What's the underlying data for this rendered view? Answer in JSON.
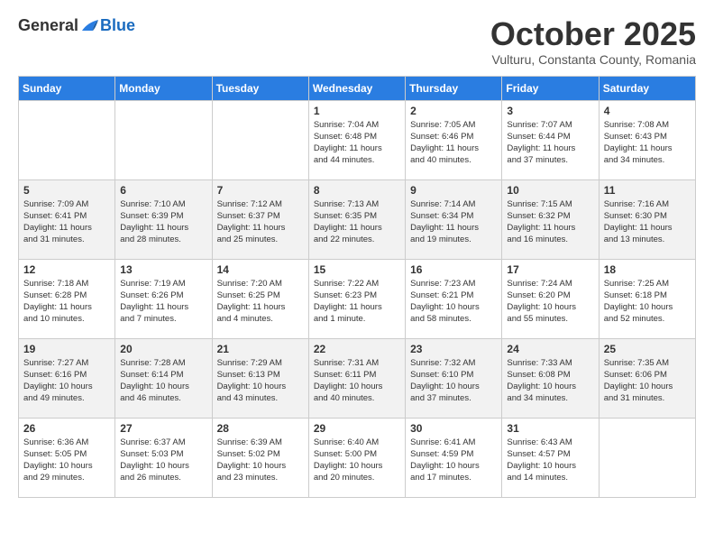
{
  "header": {
    "logo_general": "General",
    "logo_blue": "Blue",
    "month_title": "October 2025",
    "location": "Vulturu, Constanta County, Romania"
  },
  "weekdays": [
    "Sunday",
    "Monday",
    "Tuesday",
    "Wednesday",
    "Thursday",
    "Friday",
    "Saturday"
  ],
  "weeks": [
    [
      {
        "day": "",
        "info": ""
      },
      {
        "day": "",
        "info": ""
      },
      {
        "day": "",
        "info": ""
      },
      {
        "day": "1",
        "info": "Sunrise: 7:04 AM\nSunset: 6:48 PM\nDaylight: 11 hours\nand 44 minutes."
      },
      {
        "day": "2",
        "info": "Sunrise: 7:05 AM\nSunset: 6:46 PM\nDaylight: 11 hours\nand 40 minutes."
      },
      {
        "day": "3",
        "info": "Sunrise: 7:07 AM\nSunset: 6:44 PM\nDaylight: 11 hours\nand 37 minutes."
      },
      {
        "day": "4",
        "info": "Sunrise: 7:08 AM\nSunset: 6:43 PM\nDaylight: 11 hours\nand 34 minutes."
      }
    ],
    [
      {
        "day": "5",
        "info": "Sunrise: 7:09 AM\nSunset: 6:41 PM\nDaylight: 11 hours\nand 31 minutes."
      },
      {
        "day": "6",
        "info": "Sunrise: 7:10 AM\nSunset: 6:39 PM\nDaylight: 11 hours\nand 28 minutes."
      },
      {
        "day": "7",
        "info": "Sunrise: 7:12 AM\nSunset: 6:37 PM\nDaylight: 11 hours\nand 25 minutes."
      },
      {
        "day": "8",
        "info": "Sunrise: 7:13 AM\nSunset: 6:35 PM\nDaylight: 11 hours\nand 22 minutes."
      },
      {
        "day": "9",
        "info": "Sunrise: 7:14 AM\nSunset: 6:34 PM\nDaylight: 11 hours\nand 19 minutes."
      },
      {
        "day": "10",
        "info": "Sunrise: 7:15 AM\nSunset: 6:32 PM\nDaylight: 11 hours\nand 16 minutes."
      },
      {
        "day": "11",
        "info": "Sunrise: 7:16 AM\nSunset: 6:30 PM\nDaylight: 11 hours\nand 13 minutes."
      }
    ],
    [
      {
        "day": "12",
        "info": "Sunrise: 7:18 AM\nSunset: 6:28 PM\nDaylight: 11 hours\nand 10 minutes."
      },
      {
        "day": "13",
        "info": "Sunrise: 7:19 AM\nSunset: 6:26 PM\nDaylight: 11 hours\nand 7 minutes."
      },
      {
        "day": "14",
        "info": "Sunrise: 7:20 AM\nSunset: 6:25 PM\nDaylight: 11 hours\nand 4 minutes."
      },
      {
        "day": "15",
        "info": "Sunrise: 7:22 AM\nSunset: 6:23 PM\nDaylight: 11 hours\nand 1 minute."
      },
      {
        "day": "16",
        "info": "Sunrise: 7:23 AM\nSunset: 6:21 PM\nDaylight: 10 hours\nand 58 minutes."
      },
      {
        "day": "17",
        "info": "Sunrise: 7:24 AM\nSunset: 6:20 PM\nDaylight: 10 hours\nand 55 minutes."
      },
      {
        "day": "18",
        "info": "Sunrise: 7:25 AM\nSunset: 6:18 PM\nDaylight: 10 hours\nand 52 minutes."
      }
    ],
    [
      {
        "day": "19",
        "info": "Sunrise: 7:27 AM\nSunset: 6:16 PM\nDaylight: 10 hours\nand 49 minutes."
      },
      {
        "day": "20",
        "info": "Sunrise: 7:28 AM\nSunset: 6:14 PM\nDaylight: 10 hours\nand 46 minutes."
      },
      {
        "day": "21",
        "info": "Sunrise: 7:29 AM\nSunset: 6:13 PM\nDaylight: 10 hours\nand 43 minutes."
      },
      {
        "day": "22",
        "info": "Sunrise: 7:31 AM\nSunset: 6:11 PM\nDaylight: 10 hours\nand 40 minutes."
      },
      {
        "day": "23",
        "info": "Sunrise: 7:32 AM\nSunset: 6:10 PM\nDaylight: 10 hours\nand 37 minutes."
      },
      {
        "day": "24",
        "info": "Sunrise: 7:33 AM\nSunset: 6:08 PM\nDaylight: 10 hours\nand 34 minutes."
      },
      {
        "day": "25",
        "info": "Sunrise: 7:35 AM\nSunset: 6:06 PM\nDaylight: 10 hours\nand 31 minutes."
      }
    ],
    [
      {
        "day": "26",
        "info": "Sunrise: 6:36 AM\nSunset: 5:05 PM\nDaylight: 10 hours\nand 29 minutes."
      },
      {
        "day": "27",
        "info": "Sunrise: 6:37 AM\nSunset: 5:03 PM\nDaylight: 10 hours\nand 26 minutes."
      },
      {
        "day": "28",
        "info": "Sunrise: 6:39 AM\nSunset: 5:02 PM\nDaylight: 10 hours\nand 23 minutes."
      },
      {
        "day": "29",
        "info": "Sunrise: 6:40 AM\nSunset: 5:00 PM\nDaylight: 10 hours\nand 20 minutes."
      },
      {
        "day": "30",
        "info": "Sunrise: 6:41 AM\nSunset: 4:59 PM\nDaylight: 10 hours\nand 17 minutes."
      },
      {
        "day": "31",
        "info": "Sunrise: 6:43 AM\nSunset: 4:57 PM\nDaylight: 10 hours\nand 14 minutes."
      },
      {
        "day": "",
        "info": ""
      }
    ]
  ]
}
